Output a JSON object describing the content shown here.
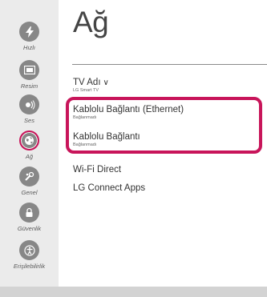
{
  "sidebar": {
    "items": [
      {
        "label": "Hızlı",
        "icon": "lightning-icon"
      },
      {
        "label": "Resim",
        "icon": "picture-icon"
      },
      {
        "label": "Ses",
        "icon": "speaker-icon"
      },
      {
        "label": "Ağ",
        "icon": "globe-icon",
        "active": true
      },
      {
        "label": "Genel",
        "icon": "general-settings-icon"
      },
      {
        "label": "Güvenlik",
        "icon": "lock-icon"
      },
      {
        "label": "Erişilebilirlik",
        "icon": "accessibility-icon"
      }
    ]
  },
  "page": {
    "title": "Ağ"
  },
  "menu": {
    "tv_name": {
      "label": "TV Adı",
      "sub": "LG Smart TV"
    },
    "wired": {
      "label": "Kablolu Bağlantı (Ethernet)",
      "sub": "Bağlanmadı"
    },
    "wireless": {
      "label": "Kablolu Bağlantı",
      "sub": "Bağlanmadı"
    },
    "wifi_direct": {
      "label": "Wi-Fi Direct"
    },
    "lg_connect": {
      "label": "LG Connect Apps"
    }
  },
  "colors": {
    "accent": "#c8155a",
    "sidebar_bg": "#ebebeb",
    "icon_bg": "#878787"
  }
}
